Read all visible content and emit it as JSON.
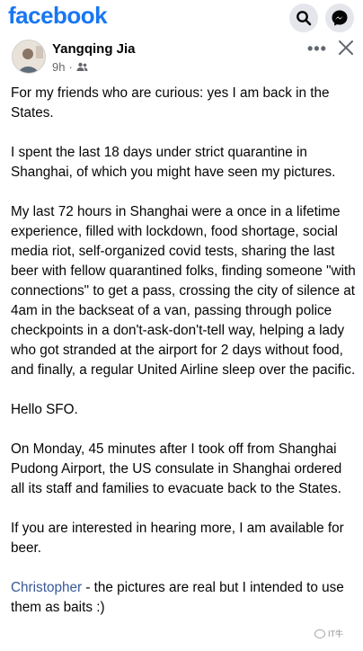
{
  "topbar": {
    "logo": "facebook",
    "search_icon": "search-icon",
    "messenger_icon": "messenger-icon",
    "colors": {
      "brand": "#1877f2",
      "button_bg": "#e4e6eb"
    }
  },
  "post": {
    "author": "Yangqing Jia",
    "time": "9h",
    "audience_icon": "friends-icon",
    "more_label": "•••",
    "paragraphs": [
      "For my friends who are curious: yes I am back in the States.",
      "I spent the last 18 days under strict quarantine in Shanghai, of which you might have seen my pictures.",
      "My last 72 hours in Shanghai were a once in a lifetime experience, filled with lockdown, food shortage, social media riot, self-organized covid tests, sharing the last beer with fellow quarantined folks, finding someone \"with connections\" to get a pass, crossing the city of silence at 4am in the backseat of a van, passing through police checkpoints in a don't-ask-don't-tell way, helping a lady who got stranded at the airport for 2 days without food, and finally, a regular United Airline sleep over the pacific.",
      "Hello SFO.",
      "On Monday, 45 minutes after I took off from Shanghai Pudong Airport, the US consulate in Shanghai ordered all its staff and families to evacuate back to the States.",
      "If you are interested in hearing more, I am available for beer."
    ],
    "last_paragraph": {
      "mention": "Christopher",
      "text": " - the pictures are real but I intended to use them as baits :)"
    },
    "colors": {
      "mention": "#385898",
      "meta": "#65676b"
    }
  },
  "watermark": "IT牛"
}
